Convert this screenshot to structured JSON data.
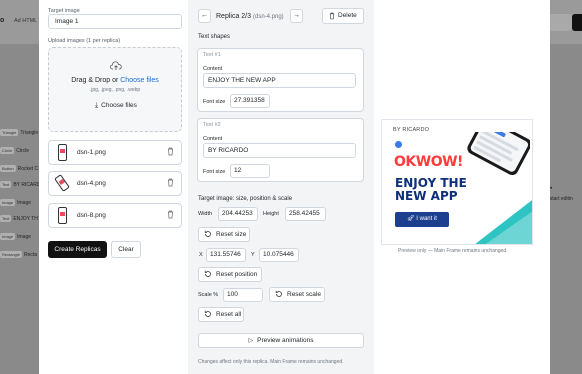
{
  "background": {
    "tab_text": "Ad HTML",
    "duplicate_label": "licate",
    "layers": [
      {
        "tag": "Triangle",
        "name": "Triangle"
      },
      {
        "tag": "Circle",
        "name": "Circle"
      },
      {
        "tag": "Button",
        "name": "Rocket C"
      },
      {
        "tag": "Text",
        "name": "BY RICARD"
      },
      {
        "tag": "Image",
        "name": "Image"
      },
      {
        "tag": "Text",
        "name": "ENJOY TH"
      },
      {
        "tag": "Image",
        "name": "Image"
      },
      {
        "tag": "Rectangle",
        "name": "Recta"
      }
    ],
    "panel_label": "anel",
    "start_hint": "e to start editin"
  },
  "left": {
    "target_label": "Target image",
    "target_value": "Image 1",
    "upload_label": "Upload images (1 per replica)",
    "drop_title": "Drag & Drop or ",
    "drop_link": "Choose files",
    "drop_formats": ".jpg, .jpeg, .png, .webp",
    "choose_button": "Choose files",
    "files": [
      "dsn-1.png",
      "dsn-4.png",
      "dsn-8.png"
    ],
    "create_button": "Create Replicas",
    "clear_button": "Clear"
  },
  "middle": {
    "prev_glyph": "←",
    "next_glyph": "→",
    "replica_title": "Replica 2/3",
    "replica_file": "(dsn-4.png)",
    "delete_button": "Delete",
    "text_shapes_label": "Text shapes",
    "texts": [
      {
        "num": "Text #1",
        "content_label": "Content",
        "content": "ENJOY THE NEW APP",
        "font_label": "Font size",
        "font_size": "27.391358"
      },
      {
        "num": "Text #2",
        "content_label": "Content",
        "content": "BY RICARDO",
        "font_label": "Font size",
        "font_size": "12"
      }
    ],
    "target_section": "Target image: size, position & scale",
    "width_label": "Width",
    "width_value": "204.44253",
    "height_label": "Height",
    "height_value": "258.42455",
    "reset_size": "Reset size",
    "x_label": "X",
    "x_value": "131.55746",
    "y_label": "Y",
    "y_value": "10.075446",
    "reset_position": "Reset position",
    "scale_label": "Scale %",
    "scale_value": "100",
    "reset_scale": "Reset scale",
    "reset_all": "Reset all",
    "preview_button": "Preview animations",
    "footnote": "Changes affect only this replica. Main Frame remains unchanged."
  },
  "preview": {
    "byline": "BY RICARDO",
    "okwow": "OKWOW!",
    "headline": "ENJOY THE NEW APP",
    "cta": "I want it",
    "note": "Preview only — Main Frame remains unchanged.",
    "colors": {
      "headline": "#0e2f7a",
      "okwow": "#ff3b3b",
      "cta": "#1d3f8f",
      "teal": "#2ec4c4"
    }
  }
}
